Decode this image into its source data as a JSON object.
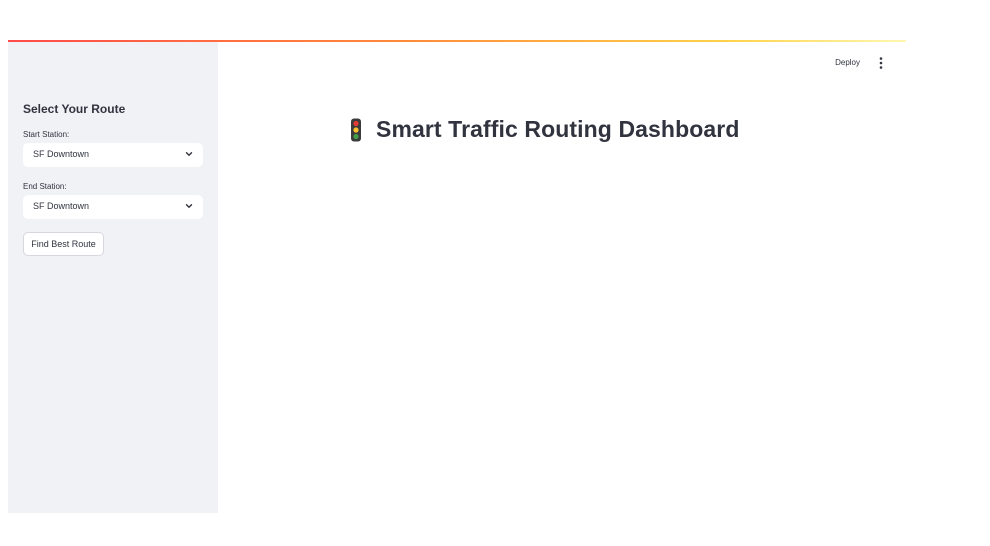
{
  "sidebar": {
    "title": "Select Your Route",
    "start": {
      "label": "Start Station:",
      "value": "SF Downtown"
    },
    "end": {
      "label": "End Station:",
      "value": "SF Downtown"
    },
    "button_label": "Find Best Route"
  },
  "header": {
    "deploy_label": "Deploy",
    "menu_icon": "vertical-ellipsis-icon"
  },
  "main": {
    "title": "Smart Traffic Routing Dashboard",
    "title_icon": "traffic-light-icon"
  },
  "colors": {
    "sidebar_bg": "#f0f2f6",
    "text": "#31333f",
    "accent_gradient_start": "#ff4b4b",
    "accent_gradient_end": "#ffd24a"
  }
}
